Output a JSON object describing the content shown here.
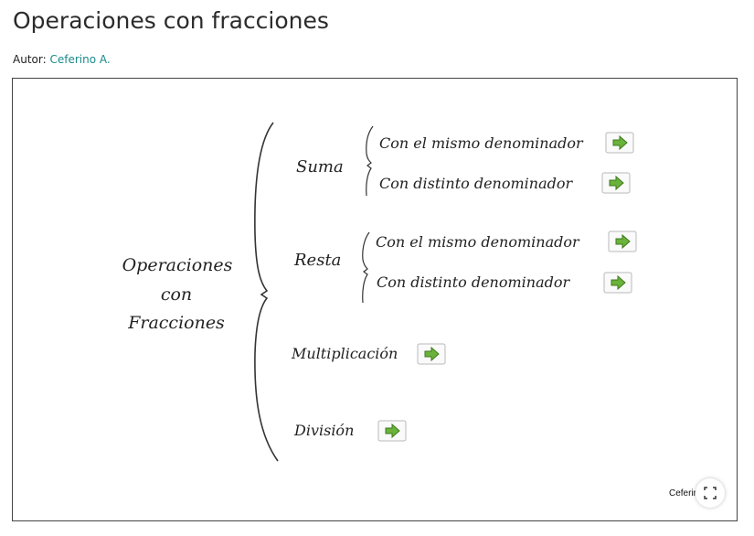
{
  "page": {
    "title": "Operaciones con fracciones",
    "author_label": "Autor:",
    "author_name": "Ceferino A."
  },
  "diagram": {
    "root": [
      "Operaciones",
      "con",
      "Fracciones"
    ],
    "suma": {
      "label": "Suma",
      "items": [
        "Con el mismo denominador",
        "Con distinto denominador"
      ]
    },
    "resta": {
      "label": "Resta",
      "items": [
        "Con el mismo denominador",
        "Con distinto denominador"
      ]
    },
    "multiplicacion": "Multiplicación",
    "division": "División",
    "arrow_icon": "green-right-arrow"
  },
  "footer": {
    "credit": "Ceferino A.",
    "fullscreen_icon": "expand-icon"
  },
  "colors": {
    "link": "#1a8a8a",
    "arrow_fill": "#6ab23a",
    "arrow_stroke": "#3e7a1c"
  }
}
